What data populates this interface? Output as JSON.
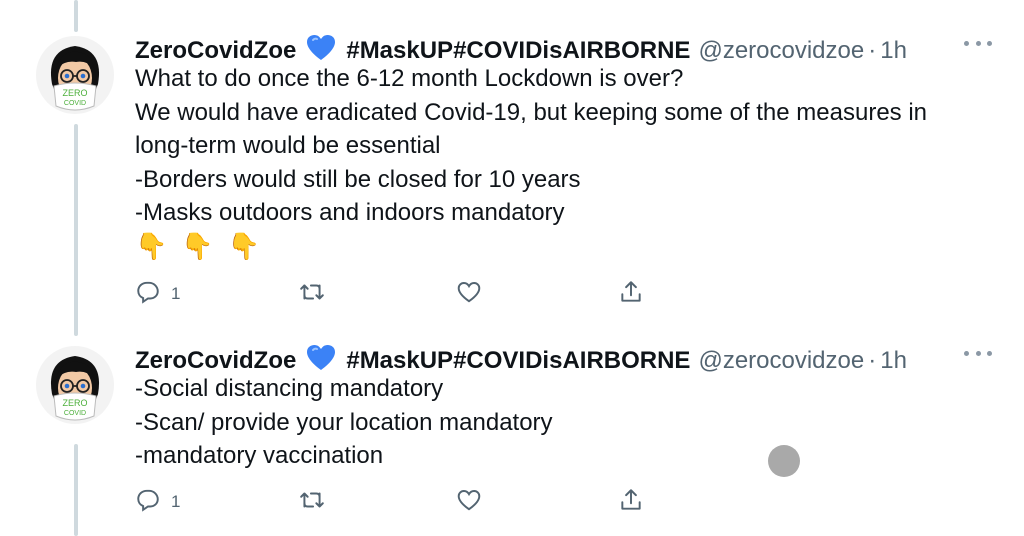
{
  "tweets": [
    {
      "author": {
        "name": "ZeroCovidZoe",
        "hashtags": "#MaskUP#COVIDisAIRBORNE",
        "handle": "@zerocovidzoe",
        "separator": "·",
        "time": "1h",
        "avatar_text_top": "ZERO",
        "avatar_text_bottom": "COVID"
      },
      "lines": [
        "What to do once the 6-12 month Lockdown is over?",
        "We would have eradicated Covid-19, but keeping some of the measures in",
        "long-term would be essential",
        "-Borders would still be closed for 10 years",
        "-Masks outdoors and indoors mandatory"
      ],
      "emojis": [
        "👇",
        "👇",
        "👇"
      ],
      "reply_count": "1"
    },
    {
      "author": {
        "name": "ZeroCovidZoe",
        "hashtags": "#MaskUP#COVIDisAIRBORNE",
        "handle": "@zerocovidzoe",
        "separator": "·",
        "time": "1h",
        "avatar_text_top": "ZERO",
        "avatar_text_bottom": "COVID"
      },
      "lines": [
        "-Social distancing mandatory",
        "-Scan/ provide your location mandatory",
        "-mandatory vaccination"
      ],
      "reply_count": "1"
    }
  ],
  "icons": {
    "verified_heart": "blue-heart-icon",
    "reply": "reply-icon",
    "retweet": "retweet-icon",
    "like": "like-icon",
    "share": "share-icon",
    "more": "more-icon"
  },
  "colors": {
    "heart_blue": "#3b82f6",
    "thread_line": "#cfd9de",
    "secondary_text": "#536471",
    "zero_covid_green": "#4caf3a"
  }
}
